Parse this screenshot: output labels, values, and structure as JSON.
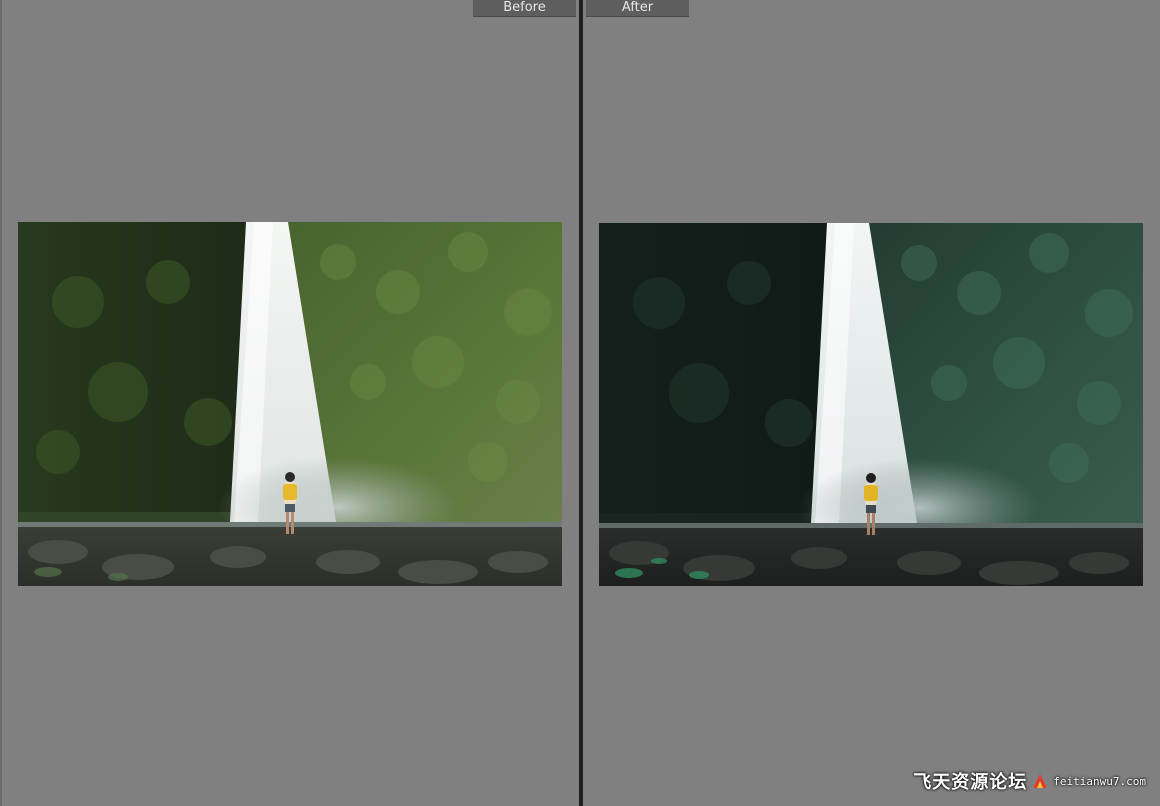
{
  "view": {
    "before_label": "Before",
    "after_label": "After"
  },
  "watermark": {
    "text": "飞天资源论坛",
    "url": "feitianwu7.com"
  },
  "colors": {
    "background": "#808080",
    "divider": "#1e1e1e",
    "tab": "#5e5e5e",
    "tab_text": "#e6e6e6"
  }
}
